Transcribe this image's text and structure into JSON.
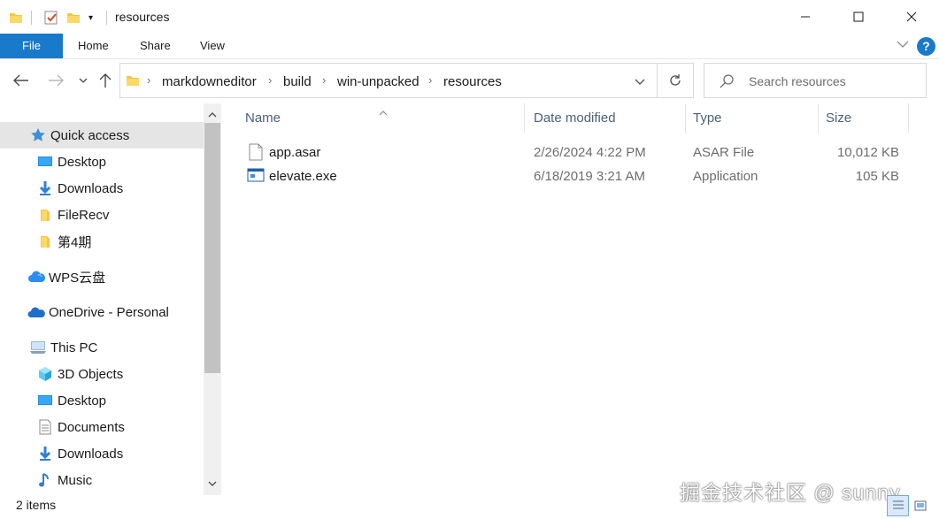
{
  "window": {
    "title": "resources"
  },
  "ribbon": {
    "tabs": [
      "File",
      "Home",
      "Share",
      "View"
    ],
    "help_label": "?"
  },
  "address": {
    "crumbs": [
      "markdowneditor",
      "build",
      "win-unpacked",
      "resources"
    ]
  },
  "search": {
    "placeholder": "Search resources"
  },
  "nav": {
    "items": [
      {
        "label": "Quick access",
        "icon": "star-icon"
      },
      {
        "label": "Desktop",
        "icon": "desktop-icon"
      },
      {
        "label": "Downloads",
        "icon": "download-arrow-icon"
      },
      {
        "label": "FileRecv",
        "icon": "folder-icon"
      },
      {
        "label": "第4期",
        "icon": "folder-icon"
      },
      {
        "label": "WPS云盘",
        "icon": "cloud-icon"
      },
      {
        "label": "OneDrive - Personal",
        "icon": "onedrive-cloud-icon"
      },
      {
        "label": "This PC",
        "icon": "computer-icon"
      },
      {
        "label": "3D Objects",
        "icon": "cube-icon"
      },
      {
        "label": "Desktop",
        "icon": "desktop-icon"
      },
      {
        "label": "Documents",
        "icon": "document-icon"
      },
      {
        "label": "Downloads",
        "icon": "download-arrow-icon"
      },
      {
        "label": "Music",
        "icon": "music-note-icon"
      }
    ]
  },
  "table": {
    "columns": [
      "Name",
      "Date modified",
      "Type",
      "Size"
    ],
    "rows": [
      {
        "name": "app.asar",
        "date": "2/26/2024 4:22 PM",
        "type": "ASAR File",
        "size": "10,012 KB",
        "icon": "file-icon"
      },
      {
        "name": "elevate.exe",
        "date": "6/18/2019 3:21 AM",
        "type": "Application",
        "size": "105 KB",
        "icon": "application-icon"
      }
    ]
  },
  "status": {
    "item_count": "2 items"
  },
  "watermark": "掘金技术社区 @ sunny",
  "colors": {
    "accent": "#1979ca",
    "selected_bg": "#e5e5e5",
    "header_text": "#4c607a",
    "folder": "#f6c445"
  }
}
